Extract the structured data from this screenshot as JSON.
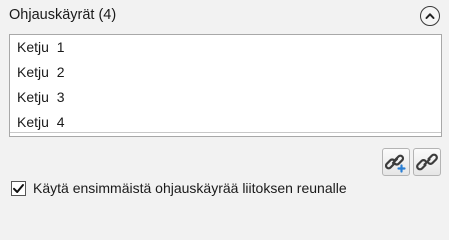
{
  "section": {
    "title": "Ohjauskäyrät (4)",
    "collapse_icon": "chevron-up-icon"
  },
  "curves": {
    "items": [
      {
        "label": "Ketju  1"
      },
      {
        "label": "Ketju  2"
      },
      {
        "label": "Ketju  3"
      },
      {
        "label": "Ketju  4"
      }
    ]
  },
  "toolbar": {
    "add_link_icon": "link-add-icon",
    "link_icon": "link-icon"
  },
  "options": {
    "use_first_curve_label": "Käytä ensimmäistä ohjauskäyrää liitoksen reunalle",
    "use_first_curve_checked": true
  },
  "colors": {
    "background": "#f2f2f2",
    "list_background": "#ffffff",
    "accent_plus": "#2a7fd4"
  }
}
